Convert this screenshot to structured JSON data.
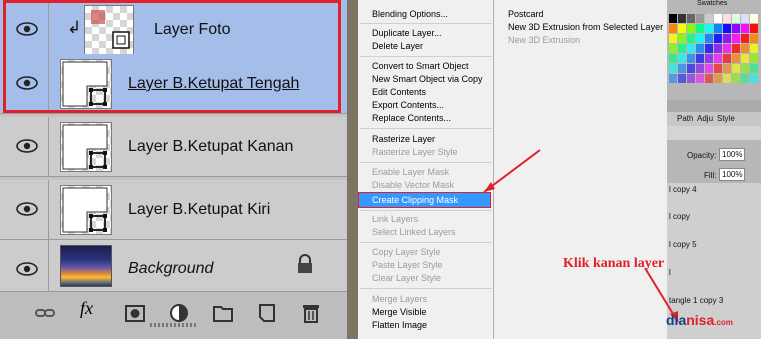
{
  "layers": [
    {
      "name": "Layer Foto",
      "selected": true,
      "clipped": true
    },
    {
      "name": "Layer B.Ketupat Tengah",
      "selected": true
    },
    {
      "name": "Layer B.Ketupat Kanan"
    },
    {
      "name": "Layer B.Ketupat Kiri"
    },
    {
      "name": "Background",
      "italic": true,
      "locked": true
    }
  ],
  "bottom_bar": {
    "fx_label": "fx"
  },
  "context_menu": {
    "items": [
      {
        "label": "Blending Options..."
      },
      {
        "label": "Duplicate Layer..."
      },
      {
        "label": "Delete Layer"
      },
      {
        "label": "Convert to Smart Object"
      },
      {
        "label": "New Smart Object via Copy"
      },
      {
        "label": "Edit Contents"
      },
      {
        "label": "Export Contents..."
      },
      {
        "label": "Replace Contents..."
      },
      {
        "label": "Rasterize Layer"
      },
      {
        "label": "Rasterize Layer Style",
        "disabled": true
      },
      {
        "label": "Enable Layer Mask",
        "disabled": true
      },
      {
        "label": "Disable Vector Mask",
        "disabled": true
      },
      {
        "label": "Create Clipping Mask",
        "highlighted": true
      },
      {
        "label": "Link Layers",
        "disabled": true
      },
      {
        "label": "Select Linked Layers",
        "disabled": true
      },
      {
        "label": "Copy Layer Style",
        "disabled": true
      },
      {
        "label": "Paste Layer Style",
        "disabled": true
      },
      {
        "label": "Clear Layer Style",
        "disabled": true
      },
      {
        "label": "Merge Layers",
        "disabled": true
      },
      {
        "label": "Merge Visible"
      },
      {
        "label": "Flatten Image"
      }
    ]
  },
  "submenu": {
    "items": [
      {
        "label": "Postcard"
      },
      {
        "label": "New 3D Extrusion from Selected Layer"
      },
      {
        "label": "New 3D Extrusion",
        "disabled": true
      }
    ]
  },
  "right_panel": {
    "tabs": [
      "Path",
      "Adju",
      "Style"
    ],
    "opacity_label": "Opacity:",
    "opacity_value": "100%",
    "fill_label": "Fill:",
    "fill_value": "100%",
    "layer_items": [
      "l copy 4",
      "l copy",
      "l copy 5",
      "l",
      "tangle 1 copy 3"
    ],
    "swatches_label": "Swatches"
  },
  "annotation": {
    "text": "Klik kanan layer",
    "color": "#e0202a"
  },
  "watermark": {
    "dia": "dia",
    "nisa": "nisa",
    ".com": ".com"
  },
  "colors": {
    "selected_row": "#a4bde9",
    "highlight": "#3399ff",
    "accent_red": "#e0202a"
  }
}
